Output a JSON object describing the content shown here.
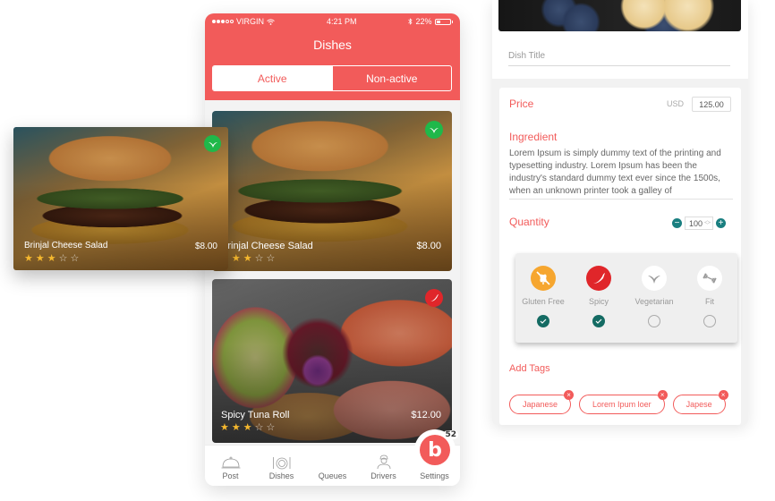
{
  "colors": {
    "brand": "#f25b5a",
    "veg_badge": "#1fb84a",
    "spicy_badge": "#e0262a",
    "gluten_free": "#f6a62f",
    "check": "#146b63",
    "qty_button": "#1a7f80",
    "star": "#f5b82e"
  },
  "phone": {
    "status": {
      "carrier": "VIRGIN",
      "time": "4:21 PM",
      "battery": "22%"
    },
    "title": "Dishes",
    "segments": {
      "active": "Active",
      "inactive": "Non-active"
    },
    "dishes": [
      {
        "name": "Brinjal Cheese Salad",
        "price": "$8.00",
        "rating": 3,
        "max_rating": 5,
        "badge": "vegetarian-icon"
      },
      {
        "name": "Spicy Tuna Roll",
        "price": "$12.00",
        "rating": 3,
        "max_rating": 5,
        "badge": "spicy-icon"
      }
    ],
    "tabbar": {
      "post": "Post",
      "dishes": "Dishes",
      "queues": "Queues",
      "queues_logo": "b",
      "queues_count": "52",
      "drivers": "Drivers",
      "settings": "Settings"
    }
  },
  "floating_card": {
    "name": "Brinjal Cheese Salad",
    "price": "$8.00",
    "rating": 3,
    "max_rating": 5,
    "badge": "vegetarian-icon"
  },
  "editor": {
    "dish_title_placeholder": "Dish Title",
    "price_label": "Price",
    "currency": "USD",
    "price_value": "125.00",
    "ingredient_label": "Ingredient",
    "ingredient_text": "Lorem Ipsum is simply dummy text of the printing and typesetting industry. Lorem Ipsum has been the industry's standard dummy text ever since the 1500s, when an unknown printer took a galley of",
    "quantity_label": "Quantity",
    "quantity_value": "100",
    "diet_tags": [
      {
        "name": "Gluten Free",
        "icon": "gluten-free-icon",
        "checked": true
      },
      {
        "name": "Spicy",
        "icon": "chili-icon",
        "checked": true
      },
      {
        "name": "Vegetarian",
        "icon": "leaf-icon",
        "checked": false
      },
      {
        "name": "Fit",
        "icon": "dumbbell-icon",
        "checked": false
      }
    ],
    "add_tags_label": "Add Tags",
    "tags": [
      "Japanese",
      "Lorem Ipum loer",
      "Japese"
    ]
  }
}
